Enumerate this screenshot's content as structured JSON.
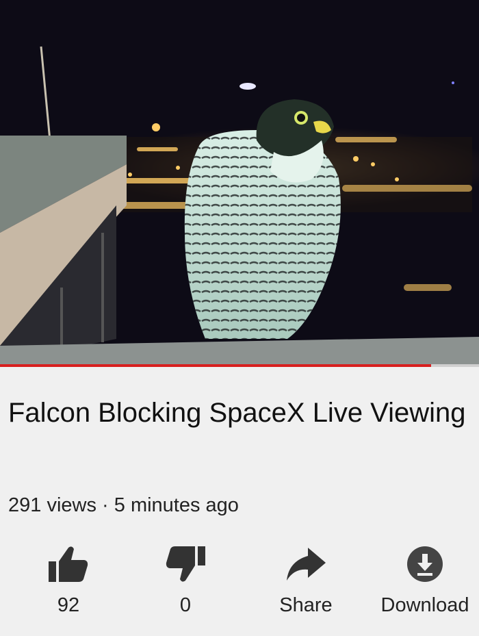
{
  "video": {
    "title": "Falcon Blocking SpaceX Live Viewing",
    "progress": 0.9
  },
  "meta": {
    "views": "291 views",
    "separator": "·",
    "time": "5 minutes ago"
  },
  "actions": {
    "like": {
      "icon": "thumbs-up-icon",
      "label": "92"
    },
    "dislike": {
      "icon": "thumbs-down-icon",
      "label": "0"
    },
    "share": {
      "icon": "share-arrow-icon",
      "label": "Share"
    },
    "download": {
      "icon": "download-icon",
      "label": "Download"
    }
  },
  "colors": {
    "progress": "#d81f1f",
    "icons": "#333333",
    "background": "#f0f0f0"
  }
}
